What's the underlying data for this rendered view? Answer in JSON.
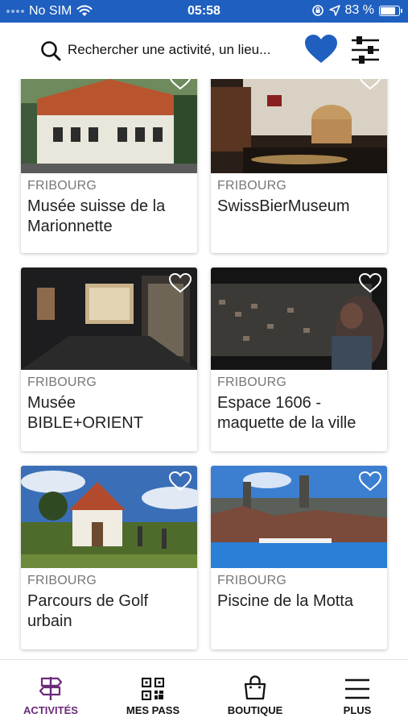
{
  "status_bar": {
    "carrier": "No SIM",
    "time": "05:58",
    "battery": "83 %",
    "battery_level": 0.83
  },
  "search": {
    "placeholder": "Rechercher une activité, un lieu..."
  },
  "cards": [
    {
      "city": "FRIBOURG",
      "title": "Musée suisse de la Marionnette",
      "image": "townhouse-photo",
      "favorite": false
    },
    {
      "city": "FRIBOURG",
      "title": "SwissBierMuseum",
      "image": "brewery-cellar-photo",
      "favorite": false
    },
    {
      "city": "FRIBOURG",
      "title": "Musée BIBLE+ORIENT",
      "image": "museum-vitrines-photo",
      "favorite": false
    },
    {
      "city": "FRIBOURG",
      "title": "Espace 1606 - maquette de la ville",
      "image": "city-model-photo",
      "favorite": false
    },
    {
      "city": "FRIBOURG",
      "title": "Parcours de Golf urbain",
      "image": "chapel-garden-photo",
      "favorite": false
    },
    {
      "city": "FRIBOURG",
      "title": "Piscine de la Motta",
      "image": "pool-cityview-photo",
      "favorite": false
    }
  ],
  "nav": {
    "items": [
      {
        "label": "ACTIVITÉS",
        "icon": "signpost-icon",
        "active": true
      },
      {
        "label": "MES PASS",
        "icon": "qr-code-icon",
        "active": false
      },
      {
        "label": "BOUTIQUE",
        "icon": "shopping-bag-icon",
        "active": false
      },
      {
        "label": "PLUS",
        "icon": "menu-icon",
        "active": false
      }
    ]
  },
  "colors": {
    "status_bar": "#1f5fbf",
    "heart": "#1f5fbf",
    "active_nav": "#6b2a7a"
  }
}
